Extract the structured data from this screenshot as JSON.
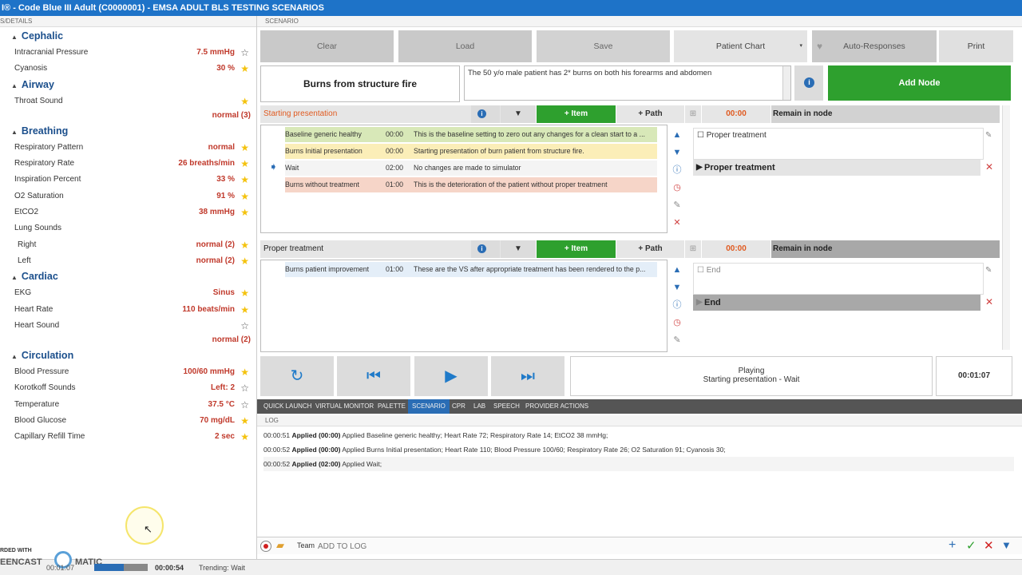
{
  "window": {
    "title": "I® - Code Blue III Adult (C0000001) - EMSA ADULT BLS TESTING SCENARIOS"
  },
  "left": {
    "header": "S/DETAILS",
    "sections": [
      {
        "title": "Cephalic",
        "rows": [
          {
            "label": "Intracranial Pressure",
            "value": "7.5 mmHg",
            "starred": false
          },
          {
            "label": "Cyanosis",
            "value": "30 %",
            "starred": true
          }
        ]
      },
      {
        "title": "Airway",
        "rows": [
          {
            "label": "Throat Sound",
            "value": "",
            "starred": true,
            "sub": "normal (3)"
          }
        ]
      },
      {
        "title": "Breathing",
        "rows": [
          {
            "label": "Respiratory Pattern",
            "value": "normal",
            "starred": true
          },
          {
            "label": "Respiratory Rate",
            "value": "26 breaths/min",
            "starred": true
          },
          {
            "label": "Inspiration Percent",
            "value": "33 %",
            "starred": true
          },
          {
            "label": "O2 Saturation",
            "value": "91 %",
            "starred": true
          },
          {
            "label": "EtCO2",
            "value": "38 mmHg",
            "starred": true
          },
          {
            "label": "Lung Sounds",
            "value": "",
            "starred": null
          },
          {
            "label": "Right",
            "value": "normal (2)",
            "starred": true
          },
          {
            "label": "Left",
            "value": "normal (2)",
            "starred": true
          }
        ]
      },
      {
        "title": "Cardiac",
        "rows": [
          {
            "label": "EKG",
            "value": "Sinus",
            "starred": true
          },
          {
            "label": "Heart Rate",
            "value": "110 beats/min",
            "starred": true
          },
          {
            "label": "Heart Sound",
            "value": "",
            "starred": false,
            "sub": "normal (2)"
          }
        ]
      },
      {
        "title": "Circulation",
        "rows": [
          {
            "label": "Blood Pressure",
            "value": "100/60 mmHg",
            "starred": true
          },
          {
            "label": "Korotkoff Sounds",
            "value": "Left: 2",
            "starred": false
          },
          {
            "label": "Temperature",
            "value": "37.5 °C",
            "starred": false
          },
          {
            "label": "Blood Glucose",
            "value": "70 mg/dL",
            "starred": true
          },
          {
            "label": "Capillary Refill Time",
            "value": "2 sec",
            "starred": true
          }
        ]
      }
    ]
  },
  "scenario": {
    "header": "SCENARIO",
    "toolbar": {
      "clear": "Clear",
      "load": "Load",
      "save": "Save",
      "patient_chart": "Patient Chart",
      "auto_responses": "Auto-Responses",
      "print": "Print"
    },
    "name": "Burns from structure fire",
    "description": "The 50 y/o male patient has 2* burns on both his forearms and abdomen",
    "add_node": "Add Node",
    "node1": {
      "title": "Starting presentation",
      "add_item": "+ Item",
      "add_path": "+ Path",
      "time": "00:00",
      "remain": "Remain in node",
      "items": [
        {
          "name": "Baseline generic healthy",
          "time": "00:00",
          "desc": "This is the baseline setting to zero out any changes for a clean start to a ..."
        },
        {
          "name": "Burns Initial presentation",
          "time": "00:00",
          "desc": "Starting presentation of burn patient from structure fire."
        },
        {
          "name": "Wait",
          "time": "02:00",
          "desc": "No changes are made to simulator"
        },
        {
          "name": "Burns without treatment",
          "time": "01:00",
          "desc": "This is the deterioration of the patient without proper treatment"
        }
      ],
      "path_check": "Proper treatment",
      "path_name": "Proper treatment"
    },
    "node2": {
      "title": "Proper treatment",
      "add_item": "+ Item",
      "add_path": "+ Path",
      "time": "00:00",
      "remain": "Remain in node",
      "items": [
        {
          "name": "Burns patient improvement",
          "time": "01:00",
          "desc": "These are the VS after appropriate treatment has been rendered to the p..."
        }
      ],
      "path_check": "End",
      "path_name": "End"
    },
    "playback": {
      "status": "Playing",
      "detail": "Starting presentation - Wait",
      "elapsed": "00:01:07"
    }
  },
  "tabs": [
    "QUICK LAUNCH",
    "VIRTUAL MONITOR",
    "PALETTE",
    "SCENARIO",
    "CPR",
    "LAB",
    "SPEECH",
    "PROVIDER ACTIONS"
  ],
  "log": {
    "header": "LOG",
    "entries": [
      {
        "time": "00:00:51",
        "tag": "Applied (00:00)",
        "text": "Applied Baseline generic healthy; Heart Rate 72; Respiratory Rate 14; EtCO2 38 mmHg;"
      },
      {
        "time": "00:00:52",
        "tag": "Applied (00:00)",
        "text": "Applied Burns Initial presentation; Heart Rate 110; Blood Pressure 100/60; Respiratory Rate 26; O2 Saturation 91; Cyanosis 30;"
      },
      {
        "time": "00:00:52",
        "tag": "Applied (02:00)",
        "text": "Applied Wait;"
      }
    ],
    "team": "Team",
    "placeholder": "ADD TO LOG"
  },
  "status": {
    "watermark": "RDED WITH",
    "brand": "EENCAST",
    "brand2": "MATIC",
    "clock1": "00:01:07",
    "clock2": "00:00:54",
    "trending": "Trending: Wait"
  },
  "colors": {
    "accent": "#1e73c8",
    "green": "#2ea02e",
    "alert": "#c0392b",
    "star": "#f4c20d"
  }
}
